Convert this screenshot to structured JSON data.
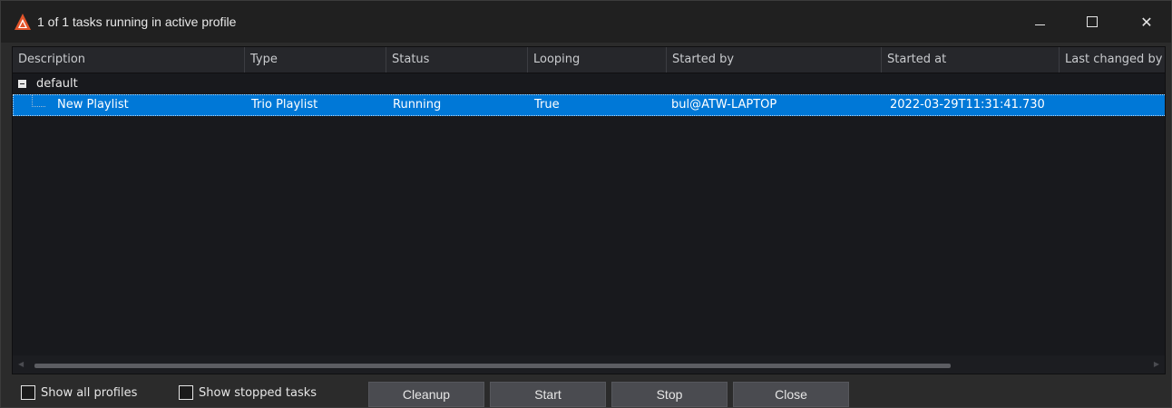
{
  "window": {
    "title": "1 of 1 tasks running in active profile",
    "brand_color": "#e2542a",
    "controls": {
      "minimize_icon": "minimize-icon",
      "maximize_icon": "maximize-icon",
      "close_glyph": "✕"
    }
  },
  "grid": {
    "columns": [
      "Description",
      "Type",
      "Status",
      "Looping",
      "Started by",
      "Started at",
      "Last changed by"
    ],
    "group": {
      "label": "default",
      "icon": "collapse-icon"
    },
    "rows": [
      {
        "description": "New Playlist",
        "type": "Trio Playlist",
        "status": "Running",
        "looping": "True",
        "started_by": "bul@ATW-LAPTOP",
        "started_at": "2022-03-29T11:31:41.730",
        "last_changed_by": ""
      }
    ],
    "selection_color": "#0078d7",
    "scrollbar": {
      "left_arrow": "◀",
      "right_arrow": "▶"
    }
  },
  "footer": {
    "show_all_profiles": {
      "label": "Show all profiles",
      "checked": false
    },
    "show_stopped_tasks": {
      "label": "Show stopped tasks",
      "checked": false
    },
    "buttons": {
      "cleanup": "Cleanup",
      "start": "Start",
      "stop": "Stop",
      "close": "Close"
    }
  }
}
